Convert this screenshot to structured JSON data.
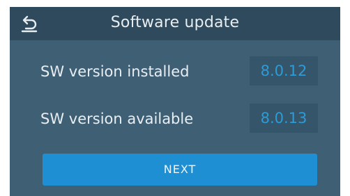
{
  "header": {
    "title": "Software update",
    "back_icon": "back-arrow-icon"
  },
  "rows": [
    {
      "label": "SW version installed",
      "value": "8.0.12"
    },
    {
      "label": "SW version available",
      "value": "8.0.13"
    }
  ],
  "actions": {
    "next_label": "NEXT"
  },
  "colors": {
    "background": "#3f5f75",
    "header": "#2f4a5c",
    "value_box": "#35556a",
    "value_text": "#2e9bd6",
    "button": "#1e8fd2"
  }
}
